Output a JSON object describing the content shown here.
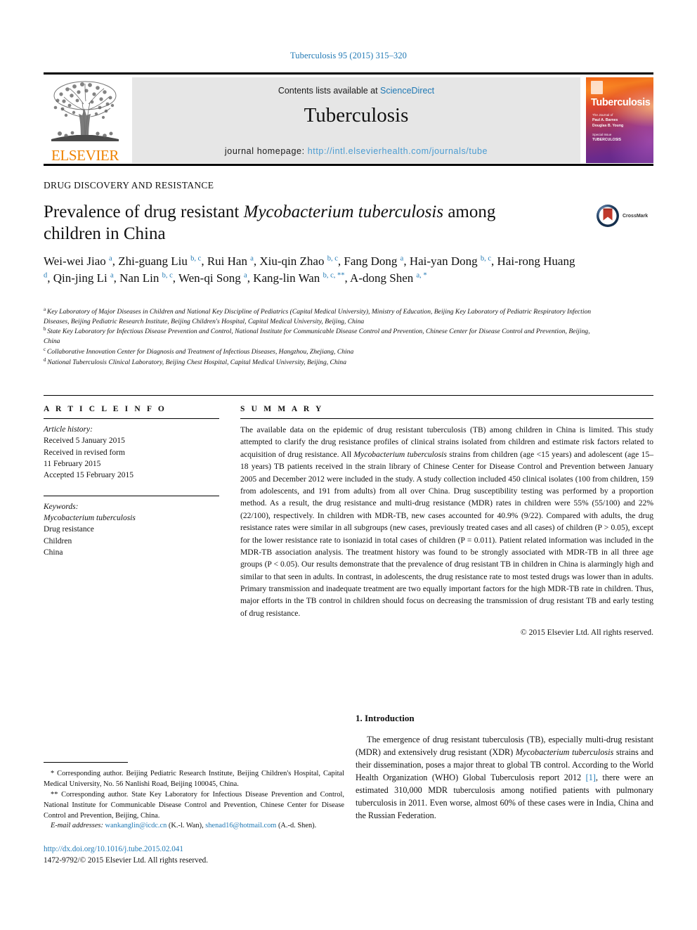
{
  "running_head": "Tuberculosis 95 (2015) 315–320",
  "masthead": {
    "contents_prefix": "Contents lists available at ",
    "sciencedirect": "ScienceDirect",
    "journal_name": "Tuberculosis",
    "homepage_label": "journal homepage: ",
    "homepage_url": "http://intl.elsevierhealth.com/journals/tube",
    "publisher": "ELSEVIER",
    "cover": {
      "title": "Tuberculosis",
      "line1": "The Journal of",
      "line2": "Paul A. Barnes",
      "line3": "Douglas B. Young",
      "line4": "Special Issue",
      "line5": "TUBERCULOSIS"
    }
  },
  "article": {
    "kicker": "DRUG DISCOVERY AND RESISTANCE",
    "title_part1": "Prevalence of drug resistant ",
    "title_italic": "Mycobacterium tuberculosis",
    "title_part2": " among children in China",
    "crossmark_label": "CrossMark"
  },
  "authors": [
    {
      "name": "Wei-wei Jiao",
      "sup": "a"
    },
    {
      "name": "Zhi-guang Liu",
      "sup": "b, c"
    },
    {
      "name": "Rui Han",
      "sup": "a"
    },
    {
      "name": "Xiu-qin Zhao",
      "sup": "b, c"
    },
    {
      "name": "Fang Dong",
      "sup": "a"
    },
    {
      "name": "Hai-yan Dong",
      "sup": "b, c"
    },
    {
      "name": "Hai-rong Huang",
      "sup": "d"
    },
    {
      "name": "Qin-jing Li",
      "sup": "a"
    },
    {
      "name": "Nan Lin",
      "sup": "b, c"
    },
    {
      "name": "Wen-qi Song",
      "sup": "a"
    },
    {
      "name": "Kang-lin Wan",
      "sup": "b, c, **"
    },
    {
      "name": "A-dong Shen",
      "sup": "a, *"
    }
  ],
  "affiliations": [
    {
      "mark": "a",
      "text": "Key Laboratory of Major Diseases in Children and National Key Discipline of Pediatrics (Capital Medical University), Ministry of Education, Beijing Key Laboratory of Pediatric Respiratory Infection Diseases, Beijing Pediatric Research Institute, Beijing Children's Hospital, Capital Medical University, Beijing, China"
    },
    {
      "mark": "b",
      "text": "State Key Laboratory for Infectious Disease Prevention and Control, National Institute for Communicable Disease Control and Prevention, Chinese Center for Disease Control and Prevention, Beijing, China"
    },
    {
      "mark": "c",
      "text": "Collaborative Innovation Center for Diagnosis and Treatment of Infectious Diseases, Hangzhou, Zhejiang, China"
    },
    {
      "mark": "d",
      "text": "National Tuberculosis Clinical Laboratory, Beijing Chest Hospital, Capital Medical University, Beijing, China"
    }
  ],
  "article_info": {
    "heading": "A R T I C L E  I N F O",
    "history_label": "Article history:",
    "history_lines": [
      "Received 5 January 2015",
      "Received in revised form",
      "11 February 2015",
      "Accepted 15 February 2015"
    ],
    "keywords_label": "Keywords:",
    "keywords": [
      "Mycobacterium tuberculosis",
      "Drug resistance",
      "Children",
      "China"
    ]
  },
  "summary": {
    "heading": "S U M M A R Y",
    "p1a": "The available data on the epidemic of drug resistant tuberculosis (TB) among children in China is limited. This study attempted to clarify the drug resistance profiles of clinical strains isolated from children and estimate risk factors related to acquisition of drug resistance. All ",
    "p1_italic": "Mycobacterium tuberculosis",
    "p1b": " strains from children (age <15 years) and adolescent (age 15–18 years) TB patients received in the strain library of Chinese Center for Disease Control and Prevention between January 2005 and December 2012 were included in the study. A study collection included 450 clinical isolates (100 from children, 159 from adolescents, and 191 from adults) from all over China. Drug susceptibility testing was performed by a proportion method. As a result, the drug resistance and multi-drug resistance (MDR) rates in children were 55% (55/100) and 22% (22/100), respectively. In children with MDR-TB, new cases accounted for 40.9% (9/22). Compared with adults, the drug resistance rates were similar in all subgroups (new cases, previously treated cases and all cases) of children (P > 0.05), except for the lower resistance rate to isoniazid in total cases of children (P = 0.011). Patient related information was included in the MDR-TB association analysis. The treatment history was found to be strongly associated with MDR-TB in all three age groups (P < 0.05). Our results demonstrate that the prevalence of drug resistant TB in children in China is alarmingly high and similar to that seen in adults. In contrast, in adolescents, the drug resistance rate to most tested drugs was lower than in adults. Primary transmission and inadequate treatment are two equally important factors for the high MDR-TB rate in children. Thus, major efforts in the TB control in children should focus on decreasing the transmission of drug resistant TB and early testing of drug resistance.",
    "copyright": "© 2015 Elsevier Ltd. All rights reserved."
  },
  "introduction": {
    "heading": "1. Introduction",
    "p1a": "The emergence of drug resistant tuberculosis (TB), especially multi-drug resistant (MDR) and extensively drug resistant (XDR) ",
    "p1_italic": "Mycobacterium tuberculosis",
    "p1b": " strains and their dissemination, poses a major threat to global TB control. According to the World Health Organization (WHO) Global Tuberculosis report 2012 ",
    "p1_ref": "[1]",
    "p1c": ", there were an estimated 310,000 MDR tuberculosis among notified patients with pulmonary tuberculosis in 2011. Even worse, almost 60% of these cases were in India, China and the Russian Federation."
  },
  "footnotes": {
    "corr1": "* Corresponding author. Beijing Pediatric Research Institute, Beijing Children's Hospital, Capital Medical University, No. 56 Nanlishi Road, Beijing 100045, China.",
    "corr2": "** Corresponding author. State Key Laboratory for Infectious Disease Prevention and Control, National Institute for Communicable Disease Control and Prevention, Chinese Center for Disease Control and Prevention, Beijing, China.",
    "email_label": "E-mail addresses:",
    "email1": "wankanglin@icdc.cn",
    "email1_owner": "(K.-l. Wan),",
    "email2": "shenad16@hotmail.com",
    "email2_owner": "(A.-d. Shen)."
  },
  "footer": {
    "doi": "http://dx.doi.org/10.1016/j.tube.2015.02.041",
    "issn": "1472-9792/© 2015 Elsevier Ltd. All rights reserved."
  },
  "colors": {
    "link_blue": "#1f78b4",
    "elsevier_orange": "#ef8200",
    "masthead_gray": "#e6e6e6"
  }
}
